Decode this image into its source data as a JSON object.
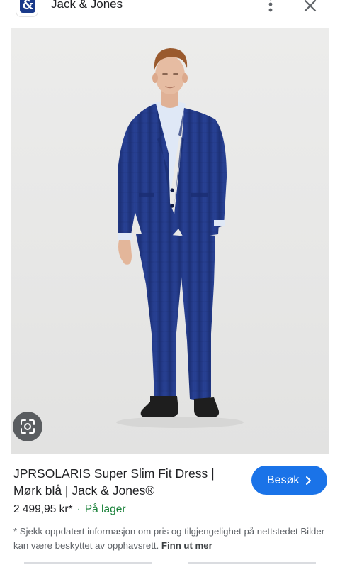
{
  "header": {
    "logo_text": "&",
    "site_name": "Jack & Jones",
    "more_icon": "more-vert-icon",
    "close_icon": "close-icon"
  },
  "product": {
    "title": "JPRSOLARIS Super Slim Fit Dress | Mørk blå | Jack & Jones®",
    "price": "2 499,95 kr*",
    "separator": "·",
    "stock": "På lager",
    "visit_label": "Besøk",
    "disclaimer": "* Sjekk oppdatert informasjon om pris og tilgjengelighet på nettstedet Bilder kan være beskyttet av opphavsrett.",
    "more_link": "Finn ut mer"
  },
  "colors": {
    "accent": "#1a73e8",
    "in_stock": "#188038",
    "suit": "#223a86",
    "logo_bg": "#1a3a8a"
  }
}
